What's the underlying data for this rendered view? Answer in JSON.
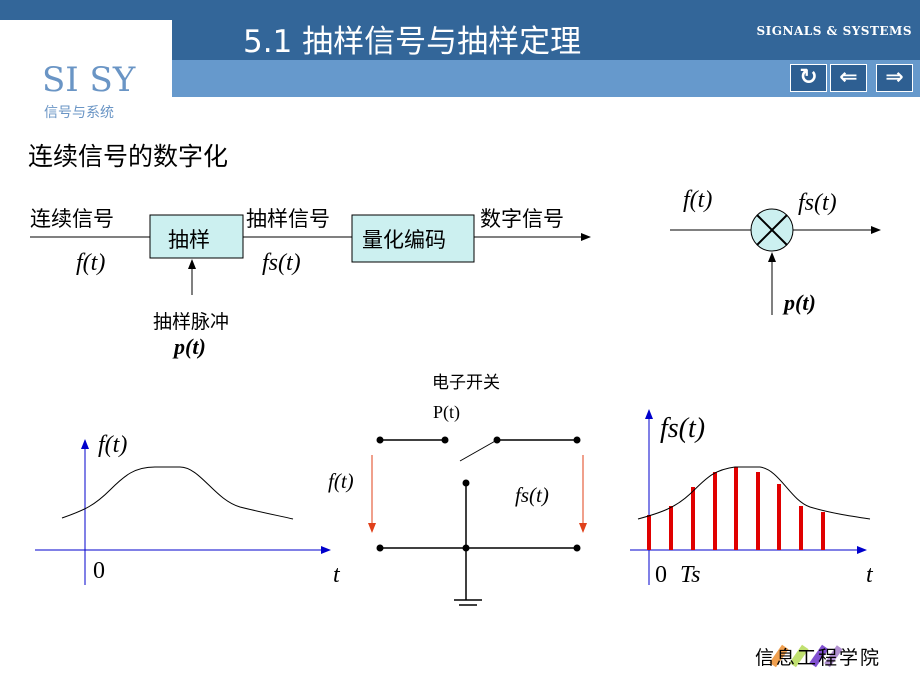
{
  "header": {
    "title": "5.1  抽样信号与抽样定理",
    "brand": "SIGNALS & SYSTEMS",
    "logo": "SI SY",
    "logo_subtitle": "信号与系统",
    "nav": {
      "refresh_icon": "refresh-icon",
      "back_icon": "arrow-left-icon",
      "forward_icon": "arrow-right-icon",
      "back_glyph": "⇐",
      "forward_glyph": "⇒",
      "refresh_glyph": "↻"
    }
  },
  "heading": "连续信号的数字化",
  "block_diagram": {
    "input_label": "连续信号",
    "input_signal": "f(t)",
    "sampler_box": "抽样",
    "sampled_label": "抽样信号",
    "sampled_signal": "fs(t)",
    "quantizer_box": "量化编码",
    "output_label": "数字信号",
    "pulse_label": "抽样脉冲",
    "pulse_signal": "p(t)",
    "box_color": "#ccf0f0"
  },
  "multiplier": {
    "input": "f(t)",
    "output": "fs(t)",
    "pulse": "p(t)"
  },
  "plot_continuous": {
    "ylabel": "f(t)",
    "origin": "0",
    "xlabel": "t"
  },
  "switch_circuit": {
    "title": "电子开关",
    "control": "P(t)",
    "input": "f(t)",
    "output": "fs(t)",
    "arrow_color": "#e0401a"
  },
  "plot_sampled": {
    "ylabel": "fs(t)",
    "origin": "0",
    "period": "Ts",
    "xlabel": "t",
    "sample_color": "#e00000",
    "axis_color": "#0000cc"
  },
  "footer": {
    "logo_text": "信息工程学院"
  }
}
